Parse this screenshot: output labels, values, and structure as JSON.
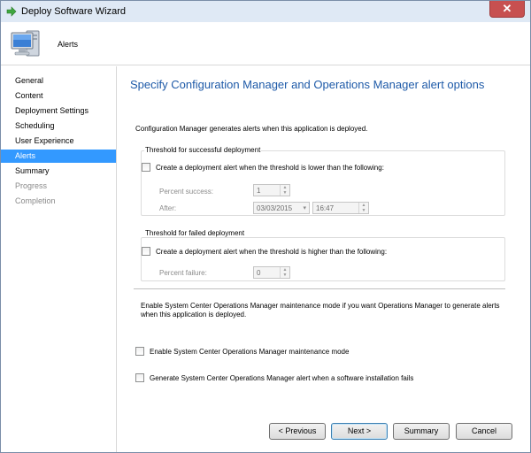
{
  "window": {
    "title": "Deploy Software Wizard",
    "close_glyph": "✕"
  },
  "header": {
    "title": "Alerts"
  },
  "sidebar": {
    "items": [
      {
        "label": "General",
        "state": "normal"
      },
      {
        "label": "Content",
        "state": "normal"
      },
      {
        "label": "Deployment Settings",
        "state": "normal"
      },
      {
        "label": "Scheduling",
        "state": "normal"
      },
      {
        "label": "User Experience",
        "state": "normal"
      },
      {
        "label": "Alerts",
        "state": "active"
      },
      {
        "label": "Summary",
        "state": "normal"
      },
      {
        "label": "Progress",
        "state": "disabled"
      },
      {
        "label": "Completion",
        "state": "disabled"
      }
    ]
  },
  "main": {
    "heading": "Specify Configuration Manager and Operations Manager alert options",
    "description": "Configuration Manager generates alerts when this application is deployed.",
    "success_group": {
      "title": "Threshold for successful deployment",
      "checkbox_label": "Create a deployment alert when the threshold is lower than the following:",
      "checked": false,
      "percent_label": "Percent success:",
      "percent_value": "1",
      "after_label": "After:",
      "date_value": "03/03/2015",
      "time_value": "16:47"
    },
    "failed_group": {
      "title": "Threshold for failed deployment",
      "checkbox_label": "Create a deployment alert when the threshold is higher than the following:",
      "checked": false,
      "percent_label": "Percent failure:",
      "percent_value": "0"
    },
    "maintenance_description": "Enable System Center Operations Manager maintenance mode if you want Operations Manager to generate alerts when this application is deployed.",
    "maintenance_checkbox_label": "Enable System Center Operations Manager maintenance mode",
    "maintenance_checked": false,
    "failure_alert_checkbox_label": "Generate System Center Operations Manager alert when a software installation fails",
    "failure_alert_checked": false
  },
  "buttons": {
    "previous": "< Previous",
    "next": "Next >",
    "summary": "Summary",
    "cancel": "Cancel"
  },
  "icons": {
    "app": "green-arrow-icon",
    "header": "computer-monitor-icon",
    "spin_up": "▲",
    "spin_down": "▼",
    "dropdown": "▾"
  },
  "colors": {
    "accent": "#3399ff",
    "heading": "#1e5aa8",
    "titlebar": "#dfe9f5",
    "close": "#c75050"
  }
}
